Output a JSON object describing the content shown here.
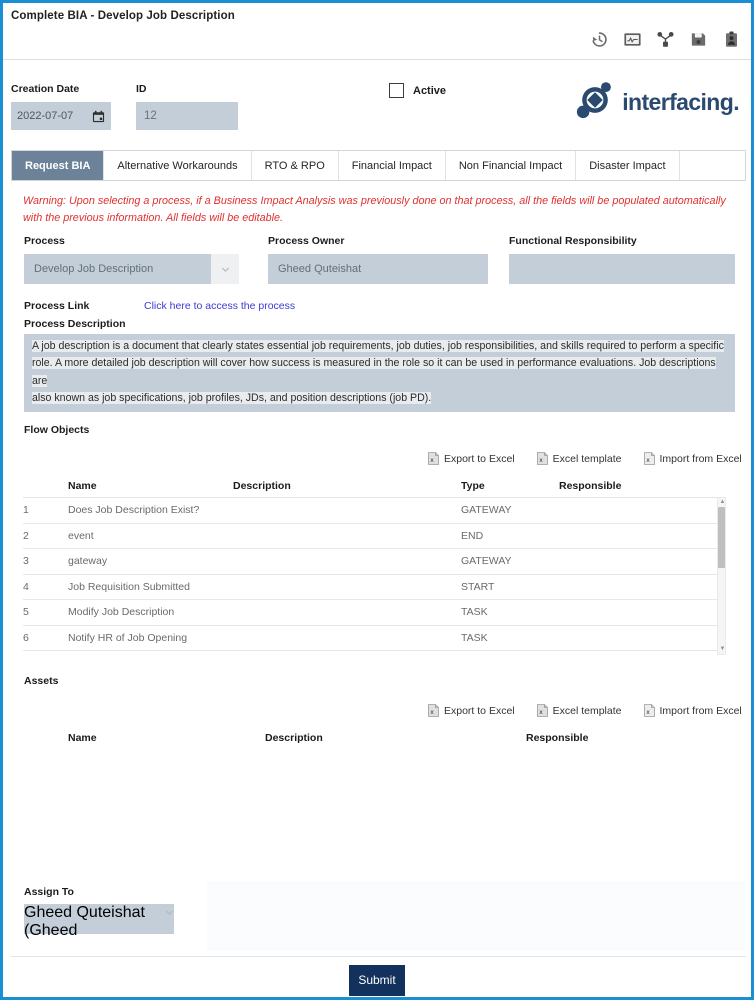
{
  "window": {
    "title": "Complete BIA - Develop Job Description"
  },
  "toolbar": {
    "icons": [
      {
        "name": "history-icon",
        "label": "History"
      },
      {
        "name": "monitor-chart-icon",
        "label": "Monitor"
      },
      {
        "name": "hierarchy-icon",
        "label": "Hierarchy"
      },
      {
        "name": "save-icon",
        "label": "Save"
      },
      {
        "name": "assignment-person-icon",
        "label": "Assignment"
      }
    ]
  },
  "meta": {
    "creation_date_label": "Creation Date",
    "creation_date_value": "2022-07-07",
    "id_label": "ID",
    "id_value": "12",
    "active_label": "Active",
    "active_checked": false,
    "logo_text": "interfacing."
  },
  "tabs": [
    {
      "label": "Request BIA",
      "active": true
    },
    {
      "label": "Alternative Workarounds",
      "active": false
    },
    {
      "label": "RTO & RPO",
      "active": false
    },
    {
      "label": "Financial Impact",
      "active": false
    },
    {
      "label": "Non Financial Impact",
      "active": false
    },
    {
      "label": "Disaster Impact",
      "active": false
    }
  ],
  "warning": "Warning: Upon selecting a process, if a Business Impact Analysis was previously done on that process, all the fields will be populated automatically with the previous information. All fields will be editable.",
  "form": {
    "process_label": "Process",
    "process_value": "Develop Job Description",
    "process_owner_label": "Process Owner",
    "process_owner_value": "Gheed Quteishat",
    "functional_responsibility_label": "Functional Responsibility",
    "functional_responsibility_value": "",
    "process_link_label": "Process Link",
    "process_link_text": "Click here to access the process",
    "process_description_label": "Process Description",
    "process_description_lines": [
      "A job description is a document that clearly states essential job requirements, job duties, job responsibilities, and skills required to perform a specific",
      "role. A more detailed job description will cover how success is measured in the role so it can be used in performance evaluations. Job descriptions are",
      "also known as job specifications, job profiles, JDs, and position descriptions (job PD)."
    ]
  },
  "excel_actions": {
    "export": "Export to Excel",
    "template": "Excel template",
    "import": "Import from Excel"
  },
  "flow_objects": {
    "title": "Flow Objects",
    "columns": {
      "name": "Name",
      "description": "Description",
      "type": "Type",
      "responsible": "Responsible"
    },
    "rows": [
      {
        "index": "1",
        "name": "Does Job Description Exist?",
        "description": "",
        "type": "GATEWAY",
        "responsible": ""
      },
      {
        "index": "2",
        "name": "event",
        "description": "",
        "type": "END",
        "responsible": ""
      },
      {
        "index": "3",
        "name": "gateway",
        "description": "",
        "type": "GATEWAY",
        "responsible": ""
      },
      {
        "index": "4",
        "name": "Job Requisition Submitted",
        "description": "",
        "type": "START",
        "responsible": ""
      },
      {
        "index": "5",
        "name": "Modify Job Description",
        "description": "",
        "type": "TASK",
        "responsible": ""
      },
      {
        "index": "6",
        "name": "Notify HR of Job Opening",
        "description": "",
        "type": "TASK",
        "responsible": ""
      }
    ]
  },
  "assets": {
    "title": "Assets",
    "columns": {
      "name": "Name",
      "description": "Description",
      "responsible": "Responsible"
    },
    "rows": []
  },
  "assign": {
    "label": "Assign To",
    "value": "Gheed Quteishat (Gheed"
  },
  "footer": {
    "submit_label": "Submit"
  },
  "colors": {
    "frame_blue": "#1b8fd4",
    "active_tab": "#6b8299",
    "field_fill": "#c3ced8",
    "warning_red": "#e03030",
    "link_blue": "#3b3bd4",
    "submit_navy": "#12315c",
    "logo_navy": "#2b4a6f"
  }
}
